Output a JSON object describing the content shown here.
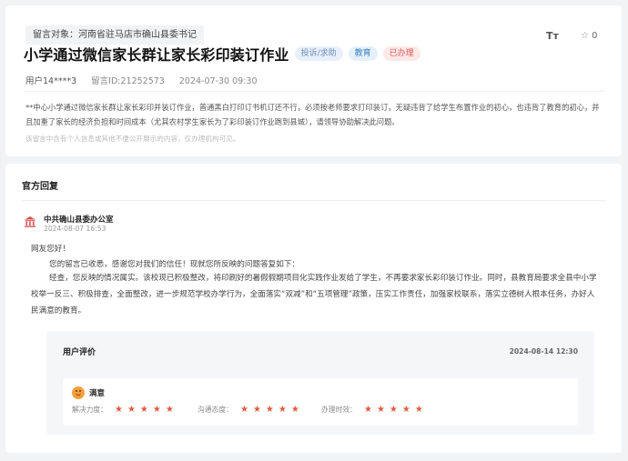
{
  "header": {
    "target_label": "留言对象：河南省驻马店市确山县委书记",
    "font_toggle_label": "Tт",
    "star_count": "0"
  },
  "message": {
    "title": "小学通过微信家长群让家长彩印装订作业",
    "tags": [
      "投诉/求助",
      "教育",
      "已办理"
    ],
    "user": "用户14****3",
    "message_id": "留言ID:21252573",
    "datetime": "2024-07-30 09:30",
    "body": "**中心小学通过微信家长群让家长彩印并装订作业，普通黑白打印订书机订还不行，必须按老师要求打印装订，无疑违背了给学生布置作业的初心，也违背了教育的初心，并且加重了家长的经济负担和时间成本（尤其农村学生家长为了彩印装订作业跑到县城），请领导协助解决此问题。",
    "disclaimer": "该留言中含有个人信息或其他不便公开展示的内容，仅办理机构可见。"
  },
  "reply": {
    "heading": "官方回复",
    "org_name": "中共确山县委办公室",
    "date": "2024-08-07 16:53",
    "greeting": "网友您好！",
    "para1": "您的留言已收悉，感谢您对我们的信任！现就您所反映的问题答复如下：",
    "para2": "经查，您反映的情况属实。该校现已积极整改，将印刷好的暑假假期项目化实践作业发给了学生，不再要求家长彩印装订作业。同时，县教育局要求全县中小学校举一反三、积极排查，全面整改，进一步规范学校办学行为，全面落实“双减”和“五项管理”政策，压实工作责任，加强家校联系，落实立德树人根本任务，办好人民满意的教育。"
  },
  "rating": {
    "title": "用户评价",
    "date": "2024-08-14 12:30",
    "overall": "满意",
    "criteria": [
      {
        "label": "解决力度：",
        "stars": 5,
        "max": 5
      },
      {
        "label": "沟通态度：",
        "stars": 5,
        "max": 5
      },
      {
        "label": "办理时效：",
        "stars": 5,
        "max": 5
      }
    ]
  },
  "colors": {
    "accent_red": "#e25a5a",
    "star": "#e05b3f",
    "tag_blue": "#3b7fc4"
  }
}
